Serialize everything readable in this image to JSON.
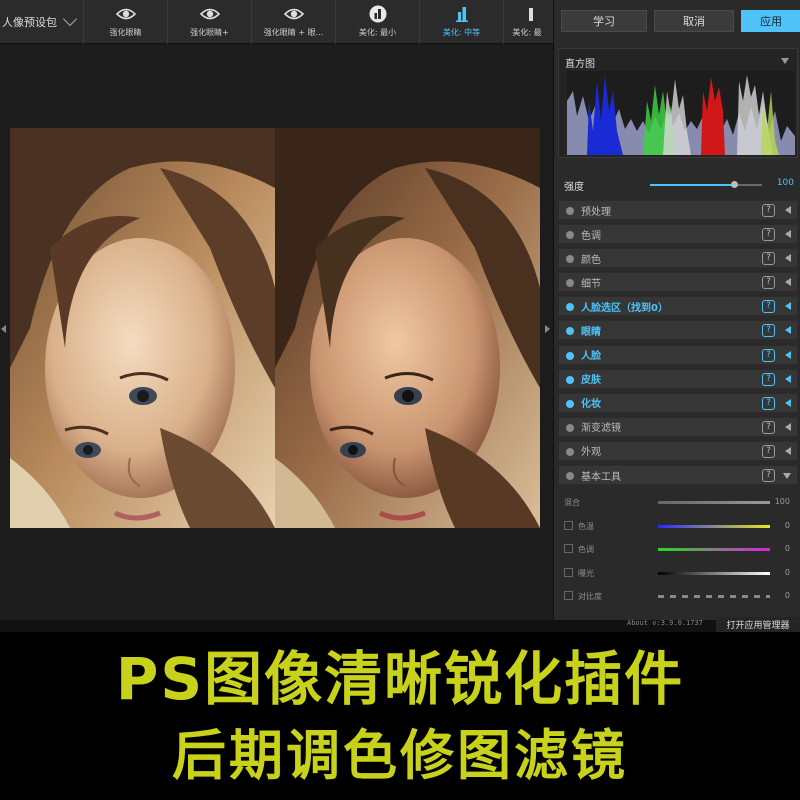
{
  "toolbar": {
    "preset_label": "人像预设包",
    "tools": [
      {
        "label": "强化眼睛",
        "icon": "eye-icon",
        "active": false
      },
      {
        "label": "强化眼睛+",
        "icon": "eye-icon",
        "active": false
      },
      {
        "label": "强化眼睛 + 眼...",
        "icon": "eye-icon",
        "active": false
      },
      {
        "label": "美化: 最小",
        "icon": "beauty-icon",
        "active": false
      },
      {
        "label": "美化: 中等",
        "icon": "beauty-icon",
        "active": true
      },
      {
        "label": "美化: 最",
        "icon": "beauty-icon",
        "active": false
      }
    ]
  },
  "panel": {
    "learn_label": "学习",
    "cancel_label": "取消",
    "apply_label": "应用",
    "histogram_title": "直方图",
    "strength_label": "强度",
    "strength_value": "100",
    "strength_fraction": 0.75,
    "sections": [
      {
        "label": "预处理",
        "on": false
      },
      {
        "label": "色调",
        "on": false
      },
      {
        "label": "颜色",
        "on": false
      },
      {
        "label": "细节",
        "on": false
      },
      {
        "label": "人脸选区（找到0）",
        "on": true
      },
      {
        "label": "眼睛",
        "on": true
      },
      {
        "label": "人脸",
        "on": true
      },
      {
        "label": "皮肤",
        "on": true
      },
      {
        "label": "化妆",
        "on": true
      },
      {
        "label": "渐变滤镜",
        "on": false
      },
      {
        "label": "外观",
        "on": false
      },
      {
        "label": "基本工具",
        "on": false
      }
    ],
    "help_glyph": "?",
    "basic_tools": [
      {
        "label": "混合",
        "value": "100",
        "has_checkbox": false,
        "gradient": [
          "#666666",
          "#999999"
        ]
      },
      {
        "label": "色温",
        "value": "0",
        "has_checkbox": true,
        "gradient": [
          "#2a2aff",
          "#e8e820"
        ]
      },
      {
        "label": "色调",
        "value": "0",
        "has_checkbox": true,
        "gradient": [
          "#22dd22",
          "#dd22dd"
        ]
      },
      {
        "label": "曝光",
        "value": "0",
        "has_checkbox": true,
        "gradient": [
          "#000000",
          "#ffffff"
        ]
      },
      {
        "label": "对比度",
        "value": "0",
        "has_checkbox": true,
        "gradient": [
          "#444444",
          "#aaaaaa"
        ]
      }
    ]
  },
  "status": {
    "about": "About v:3.9.0.1737",
    "manager_label": "打开应用管理器"
  },
  "banner": {
    "line1": "PS图像清晰锐化插件",
    "line2": "后期调色修图滤镜",
    "color": "#c8d21a"
  },
  "colors": {
    "accent": "#4fc3f7",
    "panel_bg": "#2a2a2a",
    "toolbar_bg": "#2b2b2b"
  }
}
